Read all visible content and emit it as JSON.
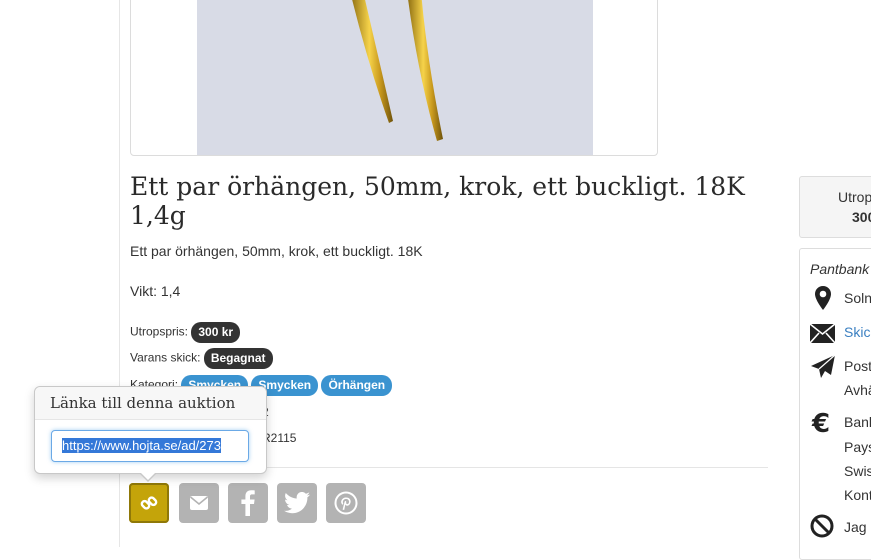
{
  "product": {
    "title": "Ett par örhängen, 50mm, krok, ett buckligt. 18K 1,4g",
    "description": "Ett par örhängen, 50mm, krok, ett buckligt. 18K",
    "weight": "Vikt: 1,4"
  },
  "meta": {
    "price_label": "Utropspris:",
    "price_value": "300 kr",
    "condition_label": "Varans skick:",
    "condition_value": "Begagnat",
    "category_label": "Kategori:",
    "categories": [
      "Smycken",
      "Smycken",
      "Örhängen"
    ],
    "row4_partial": "2",
    "row5_partial": "R2115"
  },
  "popover": {
    "title": "Länka till denna auktion",
    "url": "https://www.hojta.se/ad/273"
  },
  "share": {
    "buttons": [
      "link",
      "email",
      "facebook",
      "twitter",
      "pinterest"
    ]
  },
  "sidebar": {
    "price_label": "Utrop",
    "price_value": "300",
    "seller": "Pantbank",
    "location": "Soln",
    "contact": "Skic",
    "post_line1": "Post",
    "post_line2": "Avhä",
    "payment_line1": "Bank",
    "payment_line2": "Pays",
    "payment_line3": "Swis",
    "payment_line4": "Kont",
    "other": "Jag"
  },
  "colors": {
    "accent_gold": "#c4a40a",
    "badge_blue": "#3a93d0",
    "badge_dark": "#333333",
    "share_grey": "#b3b3b3",
    "link_blue": "#3a7fc1"
  }
}
